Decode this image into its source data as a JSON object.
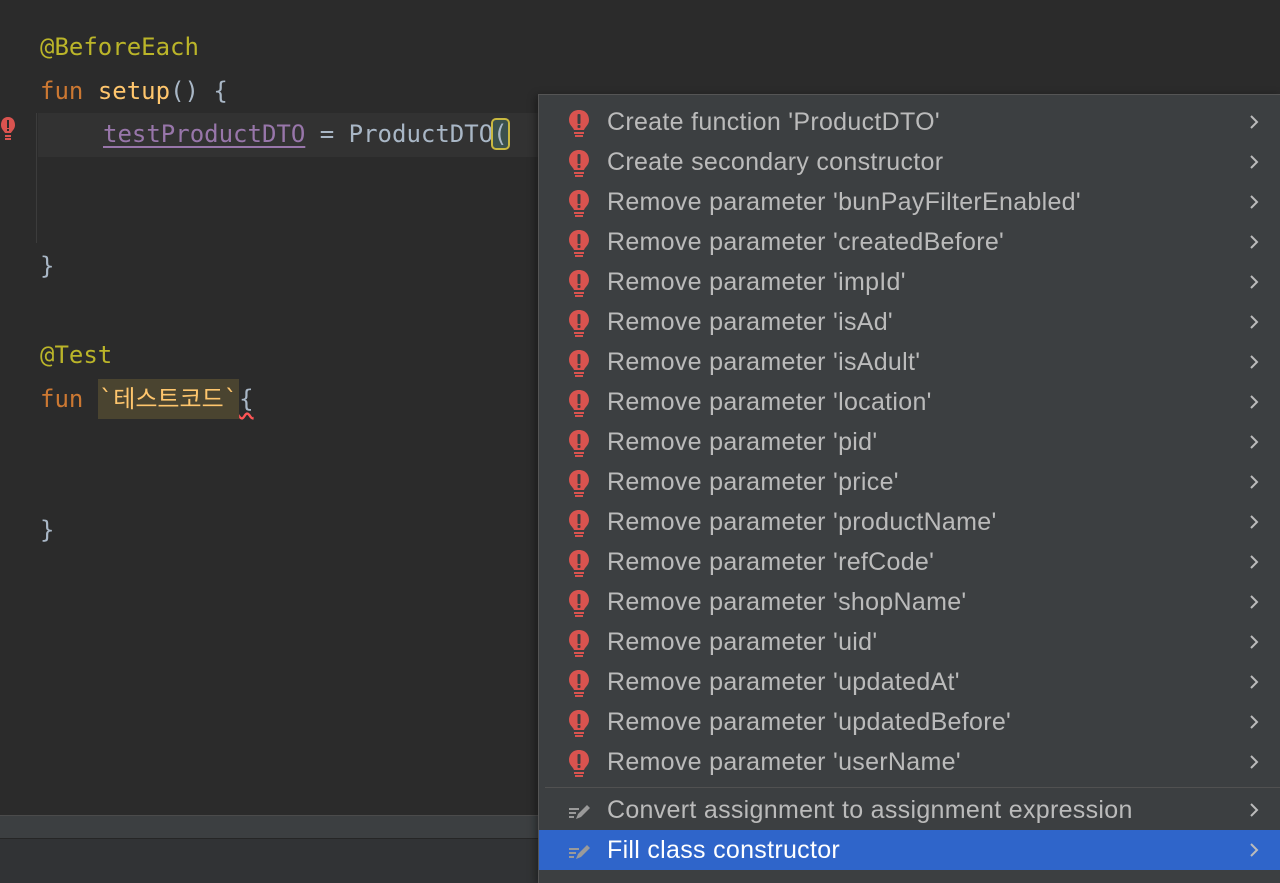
{
  "editor": {
    "lines": {
      "l1_annotation": "@BeforeEach",
      "l2_kw": "fun",
      "l2_name": "setup",
      "l2_rest": "() {",
      "l3_prop": "testProductDTO",
      "l3_eq": " = ",
      "l3_ctor": "ProductDTO",
      "l3_paren": "(",
      "l4_close": "}",
      "l5_annotation": "@Test",
      "l6_kw": "fun",
      "l6_name": "`테스트코드`",
      "l6_brace": "{",
      "l7_close": "}"
    }
  },
  "popup": {
    "error_items": [
      {
        "label": "Create function 'ProductDTO'",
        "icon": "error-bulb-icon"
      },
      {
        "label": "Create secondary constructor",
        "icon": "error-bulb-icon"
      },
      {
        "label": "Remove parameter 'bunPayFilterEnabled'",
        "icon": "error-bulb-icon"
      },
      {
        "label": "Remove parameter 'createdBefore'",
        "icon": "error-bulb-icon"
      },
      {
        "label": "Remove parameter 'impId'",
        "icon": "error-bulb-icon"
      },
      {
        "label": "Remove parameter 'isAd'",
        "icon": "error-bulb-icon"
      },
      {
        "label": "Remove parameter 'isAdult'",
        "icon": "error-bulb-icon"
      },
      {
        "label": "Remove parameter 'location'",
        "icon": "error-bulb-icon"
      },
      {
        "label": "Remove parameter 'pid'",
        "icon": "error-bulb-icon"
      },
      {
        "label": "Remove parameter 'price'",
        "icon": "error-bulb-icon"
      },
      {
        "label": "Remove parameter 'productName'",
        "icon": "error-bulb-icon"
      },
      {
        "label": "Remove parameter 'refCode'",
        "icon": "error-bulb-icon"
      },
      {
        "label": "Remove parameter 'shopName'",
        "icon": "error-bulb-icon"
      },
      {
        "label": "Remove parameter 'uid'",
        "icon": "error-bulb-icon"
      },
      {
        "label": "Remove parameter 'updatedAt'",
        "icon": "error-bulb-icon"
      },
      {
        "label": "Remove parameter 'updatedBefore'",
        "icon": "error-bulb-icon"
      },
      {
        "label": "Remove parameter 'userName'",
        "icon": "error-bulb-icon"
      }
    ],
    "intention_items": [
      {
        "label": "Convert assignment to assignment expression",
        "icon": "pencil-intention-icon",
        "selected": false
      },
      {
        "label": "Fill class constructor",
        "icon": "pencil-intention-icon",
        "selected": true
      }
    ],
    "colors": {
      "background": "#3c3f41",
      "selected": "#2f65ca",
      "error_icon": "#d9534f"
    }
  }
}
